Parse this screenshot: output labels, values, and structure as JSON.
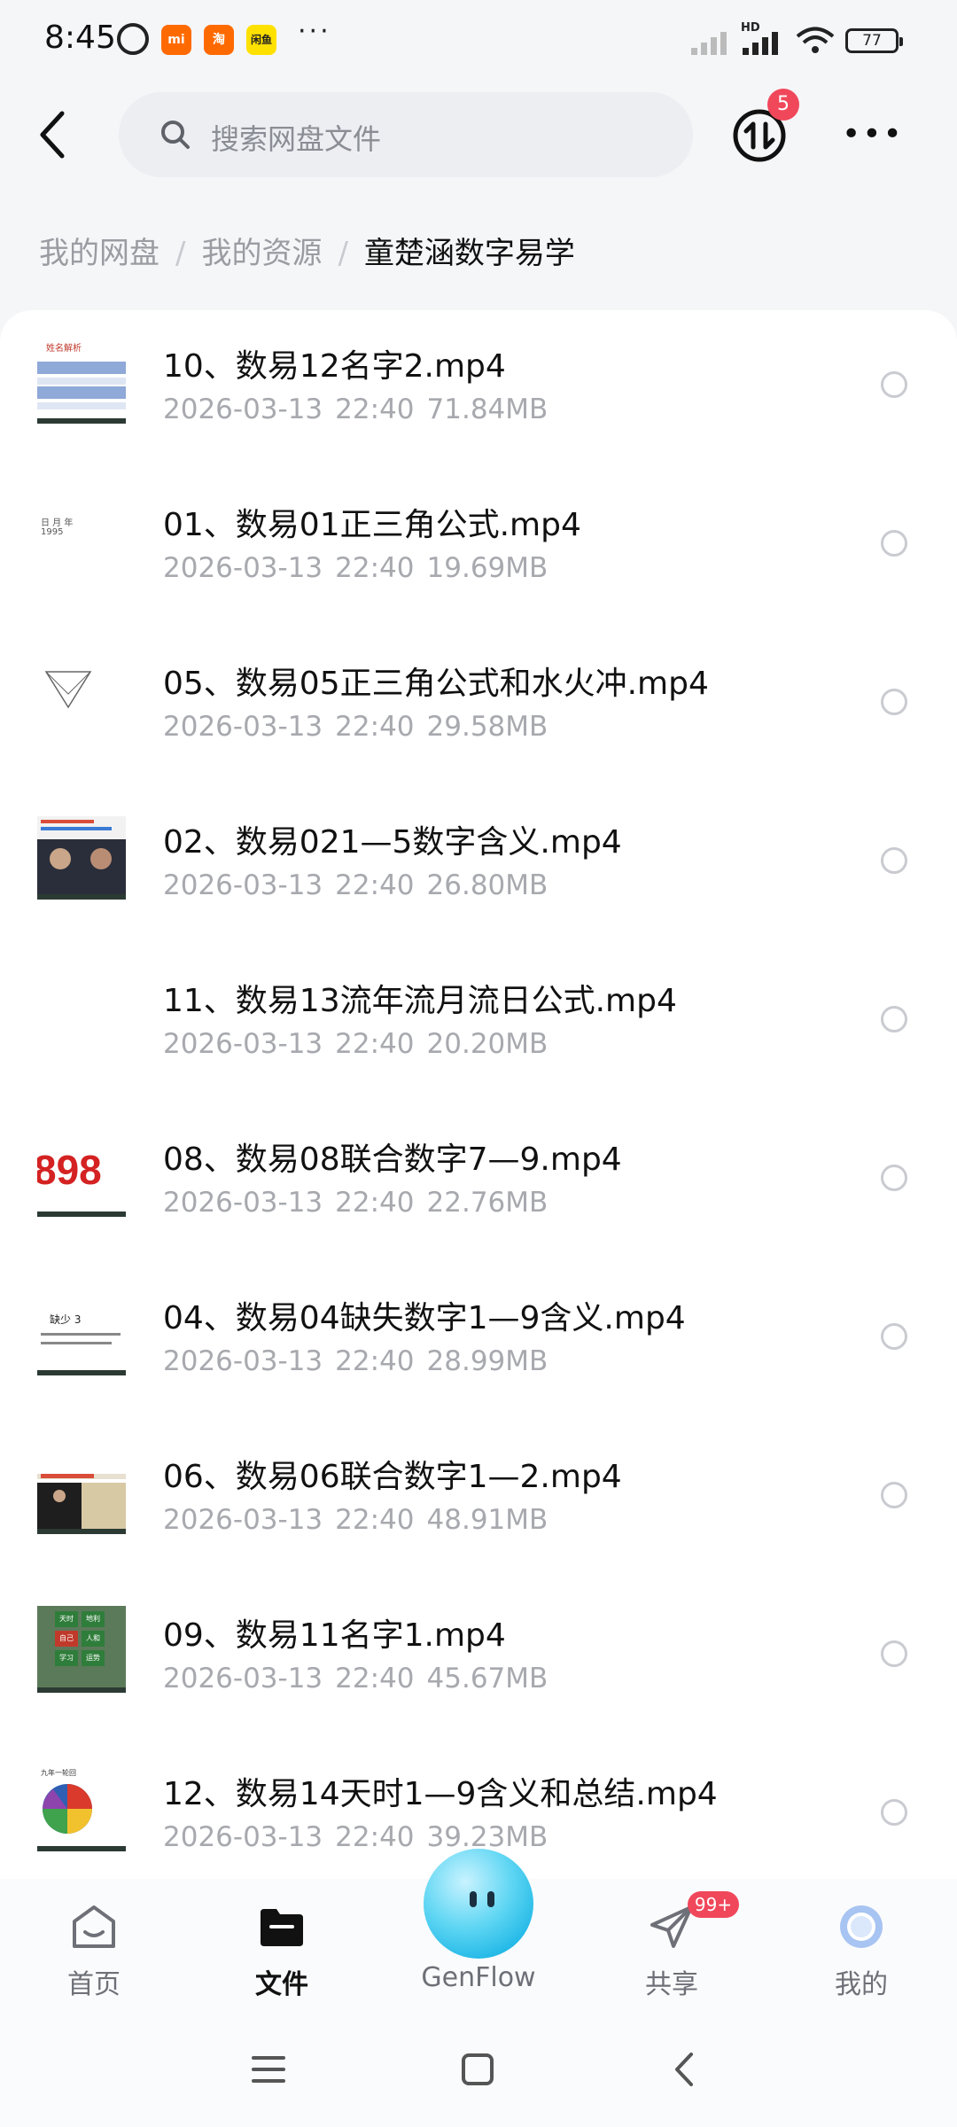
{
  "status_bar": {
    "time": "8:45",
    "apps": [
      "mi",
      "淘",
      "闲鱼"
    ],
    "more": "···",
    "network": "HD",
    "battery": "77"
  },
  "header": {
    "search_placeholder": "搜索网盘文件",
    "transfer_badge": "5"
  },
  "breadcrumb": [
    "我的网盘",
    "我的资源",
    "童楚涵数字易学"
  ],
  "files": [
    {
      "name": "10、数易12名字2.mp4",
      "date": "2026-03-13",
      "time": "22:40",
      "size": "71.84MB"
    },
    {
      "name": "01、数易01正三角公式.mp4",
      "date": "2026-03-13",
      "time": "22:40",
      "size": "19.69MB"
    },
    {
      "name": "05、数易05正三角公式和水火冲.mp4",
      "date": "2026-03-13",
      "time": "22:40",
      "size": "29.58MB"
    },
    {
      "name": "02、数易021—5数字含义.mp4",
      "date": "2026-03-13",
      "time": "22:40",
      "size": "26.80MB"
    },
    {
      "name": "11、数易13流年流月流日公式.mp4",
      "date": "2026-03-13",
      "time": "22:40",
      "size": "20.20MB"
    },
    {
      "name": "08、数易08联合数字7—9.mp4",
      "date": "2026-03-13",
      "time": "22:40",
      "size": "22.76MB"
    },
    {
      "name": "04、数易04缺失数字1—9含义.mp4",
      "date": "2026-03-13",
      "time": "22:40",
      "size": "28.99MB"
    },
    {
      "name": "06、数易06联合数字1—2.mp4",
      "date": "2026-03-13",
      "time": "22:40",
      "size": "48.91MB"
    },
    {
      "name": "09、数易11名字1.mp4",
      "date": "2026-03-13",
      "time": "22:40",
      "size": "45.67MB"
    },
    {
      "name": "12、数易14天时1—9含义和总结.mp4",
      "date": "2026-03-13",
      "time": "22:40",
      "size": "39.23MB"
    }
  ],
  "thumbs": {
    "t1_title": "姓名解析",
    "t2_text": "日 月 年",
    "t2_num": "1995",
    "t6_num": "898",
    "t7_title": "缺少 3",
    "t9_cells": [
      "天时",
      "地利",
      "自己",
      "人和",
      "学习",
      "运势"
    ],
    "t10_head": "九年一轮回"
  },
  "bottom_nav": {
    "home": "首页",
    "files": "文件",
    "genflow": "GenFlow",
    "share": "共享",
    "share_badge": "99+",
    "mine": "我的"
  },
  "colors": {
    "accent_red": "#f0475a",
    "genflow_blue": "#1fb7e6",
    "meta_gray": "#a7a9ae"
  }
}
